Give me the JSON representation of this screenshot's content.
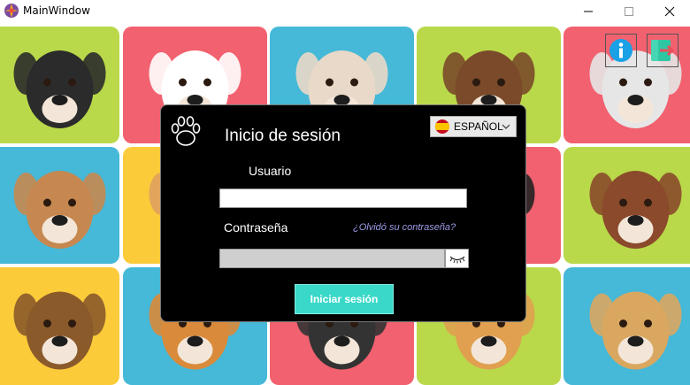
{
  "window": {
    "title": "MainWindow",
    "controls": [
      "minimize",
      "maximize",
      "close"
    ]
  },
  "background": {
    "tile_colors": {
      "lime": "#b9d94a",
      "pink": "#f2616f",
      "sky": "#46b8d8",
      "yellow": "#fbcb3a"
    }
  },
  "toolbar": {
    "info_icon": "info-icon",
    "exit_icon": "exit-icon",
    "info_color": "#1aa1e6",
    "exit_color": "#46d6b4"
  },
  "login": {
    "title": "Inicio de sesión",
    "language": "ESPAÑOL",
    "username_label": "Usuario",
    "username_value": "",
    "password_label": "Contraseña",
    "password_value": "",
    "forgot_link": "¿Olvidó su contraseña?",
    "submit_label": "Iniciar sesión",
    "submit_color": "#3ad8c9"
  }
}
